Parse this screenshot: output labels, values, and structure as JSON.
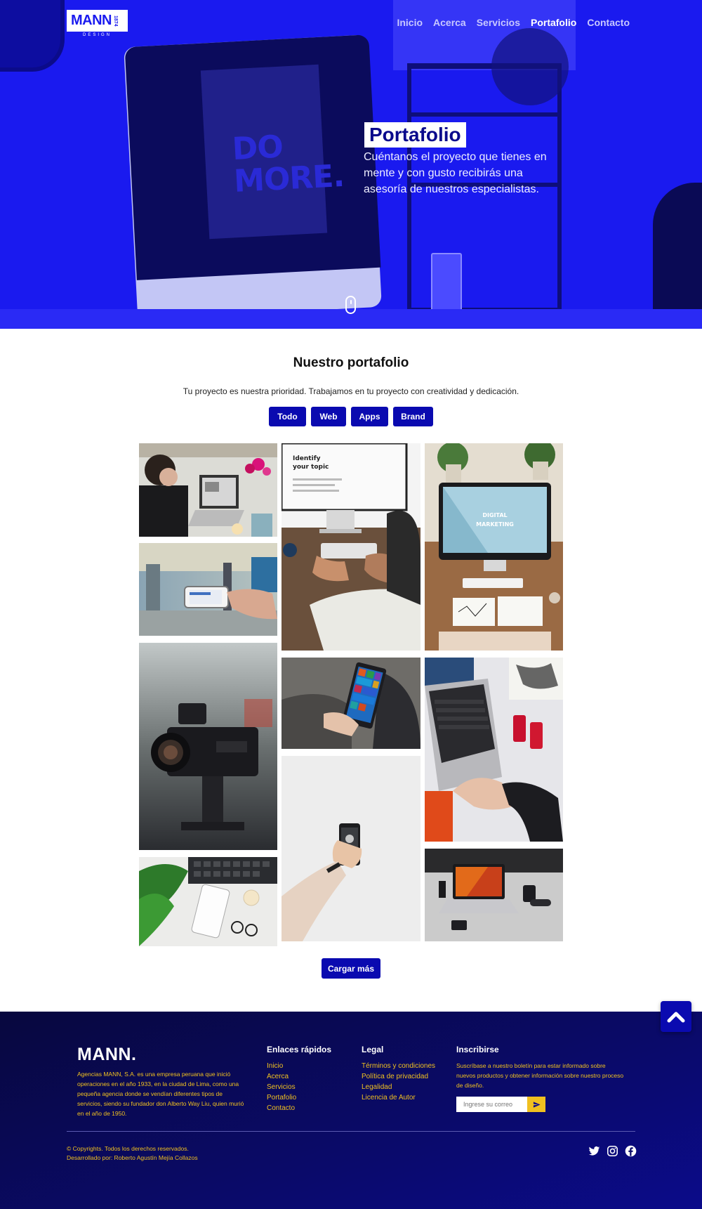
{
  "brand": {
    "logo": "MANN",
    "year": "1874",
    "subtitle": "DESIGN"
  },
  "nav": {
    "items": [
      {
        "label": "Inicio",
        "active": false
      },
      {
        "label": "Acerca",
        "active": false
      },
      {
        "label": "Servicios",
        "active": false
      },
      {
        "label": "Portafolio",
        "active": true
      },
      {
        "label": "Contacto",
        "active": false
      }
    ]
  },
  "hero": {
    "title": "Portafolio",
    "text": "Cuéntanos el proyecto que tienes en mente y con gusto recibirás una asesoría de nuestros especialistas.",
    "image_text": "DO MORE.",
    "scroll_icon": "mouse-scroll-icon"
  },
  "portfolio": {
    "title": "Nuestro portafolio",
    "subtitle": "Tu proyecto es nuestra prioridad. Trabajamos en tu proyecto con creatividad y dedicación.",
    "filters": [
      "Todo",
      "Web",
      "Apps",
      "Brand"
    ],
    "load_more": "Cargar más",
    "tiles": [
      {
        "name": "woman-laptop-photo",
        "color": "#cfcfc8"
      },
      {
        "name": "identify-topic-monitor-photo",
        "color": "#5b4a3c",
        "caption": "Identify your topic"
      },
      {
        "name": "digital-marketing-desk-photo",
        "color": "#8a5b3a",
        "caption": "DIGITAL MARKETING"
      },
      {
        "name": "street-phone-photo",
        "color": "#8aa0b0"
      },
      {
        "name": "cinema-camera-photo",
        "color": "#3b4048"
      },
      {
        "name": "windows-phone-photo",
        "color": "#6a6a68"
      },
      {
        "name": "laptop-coca-cola-photo",
        "color": "#d8d8dc"
      },
      {
        "name": "phone-hand-photo",
        "color": "#e6e6e6"
      },
      {
        "name": "plant-tablet-photo",
        "color": "#e8e8e6"
      },
      {
        "name": "macbook-desk-photo",
        "color": "#bcbcbc"
      }
    ]
  },
  "footer": {
    "logo": "MANN.",
    "about": "Agencias MANN, S.A. es una empresa peruana que inició operaciones en el año 1933, en la ciudad de Lima, como una pequeña agencia donde se vendían diferentes tipos de servicios, siendo su fundador don Alberto Way Liu, quien murió en el año de 1950.",
    "quick_links": {
      "title": "Enlaces rápidos",
      "items": [
        "Inicio",
        "Acerca",
        "Servicios",
        "Portafolio",
        "Contacto"
      ]
    },
    "legal": {
      "title": "Legal",
      "items": [
        "Términos y condiciones",
        "Política de privacidad",
        "Legalidad",
        "Licencia de Autor"
      ]
    },
    "subscribe": {
      "title": "Inscribirse",
      "text": "Suscríbase a nuestro boletín para estar informado sobre nuevos productos y obtener información sobre nuestro proceso de diseño.",
      "placeholder": "Ingrese su correo",
      "button_icon": "send-icon"
    },
    "copyright": "© Copyrights. Todos los derechos reservados.",
    "developer": "Desarrollado por: Roberto Agustín Mejía Collazos",
    "socials": [
      "twitter-icon",
      "instagram-icon",
      "facebook-icon"
    ]
  },
  "colors": {
    "primary": "#0a0ab0",
    "hero": "#1a1aef",
    "accent": "#f0c020",
    "footer": "#08083e"
  }
}
